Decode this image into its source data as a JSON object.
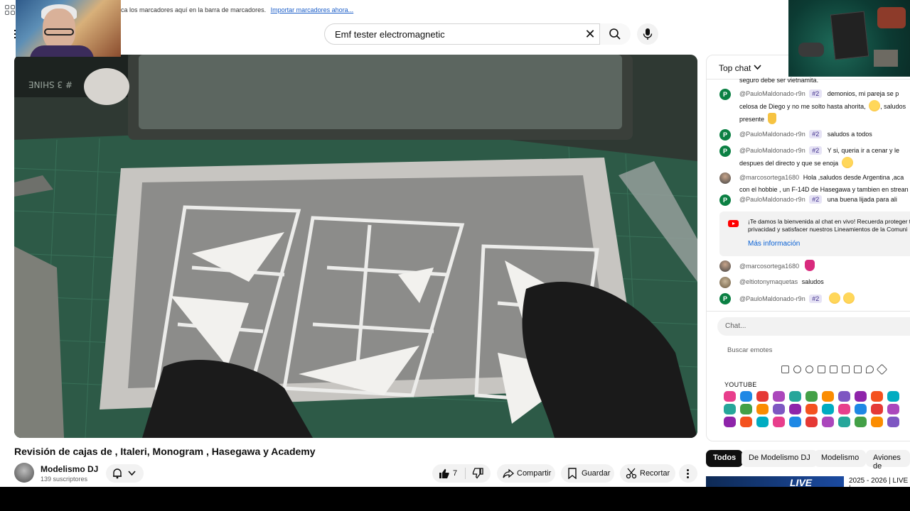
{
  "bookmarks": {
    "prompt": "ca los marcadores aquí en la barra de marcadores.",
    "import_link": "Importar marcadores ahora..."
  },
  "search": {
    "query": "Emf tester electromagnetic"
  },
  "video": {
    "title": "Revisión de cajas de , Italeri, Monogram , Hasegawa y Academy",
    "box_label": "# 3 SHINE"
  },
  "channel": {
    "name": "Modelismo DJ",
    "subscribers": "139 suscriptores"
  },
  "actions": {
    "likes": "7",
    "share": "Compartir",
    "save": "Guardar",
    "clip": "Recortar"
  },
  "chat": {
    "mode": "Top chat",
    "cut_text": "seguro debe ser vietnamita.",
    "messages": [
      {
        "avatar": "P",
        "author": "@PauloMaldonado-r9n",
        "badge": "#2",
        "text": "demonios, mi pareja se p",
        "text2": "celosa de Diego y no me solto hasta ahorita,",
        "text2b": ", saludos",
        "text3": "presente"
      },
      {
        "avatar": "P",
        "author": "@PauloMaldonado-r9n",
        "badge": "#2",
        "text": "saludos a todos"
      },
      {
        "avatar": "P",
        "author": "@PauloMaldonado-r9n",
        "badge": "#2",
        "text": "Y si, queria ir a cenar y le",
        "text2": "despues del directo y que se enoja"
      },
      {
        "avatar": "",
        "author": "@marcosortega1680",
        "text": "Hola ,saludos desde Argentina ,aca",
        "text2": "con el hobbie , un F-14D de Hasegawa y tambien en strean"
      },
      {
        "avatar": "P",
        "author": "@PauloMaldonado-r9n",
        "badge": "#2",
        "text": "una buena lijada para ali"
      },
      {
        "avatar": "",
        "author": "@marcosortega1680"
      },
      {
        "avatar": "",
        "author": "@eltiotonymaquetas",
        "text": "saludos"
      },
      {
        "avatar": "P",
        "author": "@PauloMaldonado-r9n",
        "badge": "#2"
      }
    ],
    "welcome_text": "¡Te damos la bienvenida al chat en vivo! Recuerda proteger t privacidad y satisfacer nuestros Lineamientos de la Comuni",
    "welcome_link": "Más información",
    "input_placeholder": "Chat...",
    "emote_search": "Buscar emotes",
    "emote_section": "YOUTUBE"
  },
  "chips": [
    "Todos",
    "De Modelismo DJ",
    "Modelismo",
    "Aviones de"
  ],
  "recommended": {
    "badge": "LIVE",
    "title": "2025 - 2026 | LIVE |"
  },
  "colors": {
    "accent_red": "#ff0000",
    "link_blue": "#065fd4",
    "badge_purple": "#3e2d8c"
  }
}
